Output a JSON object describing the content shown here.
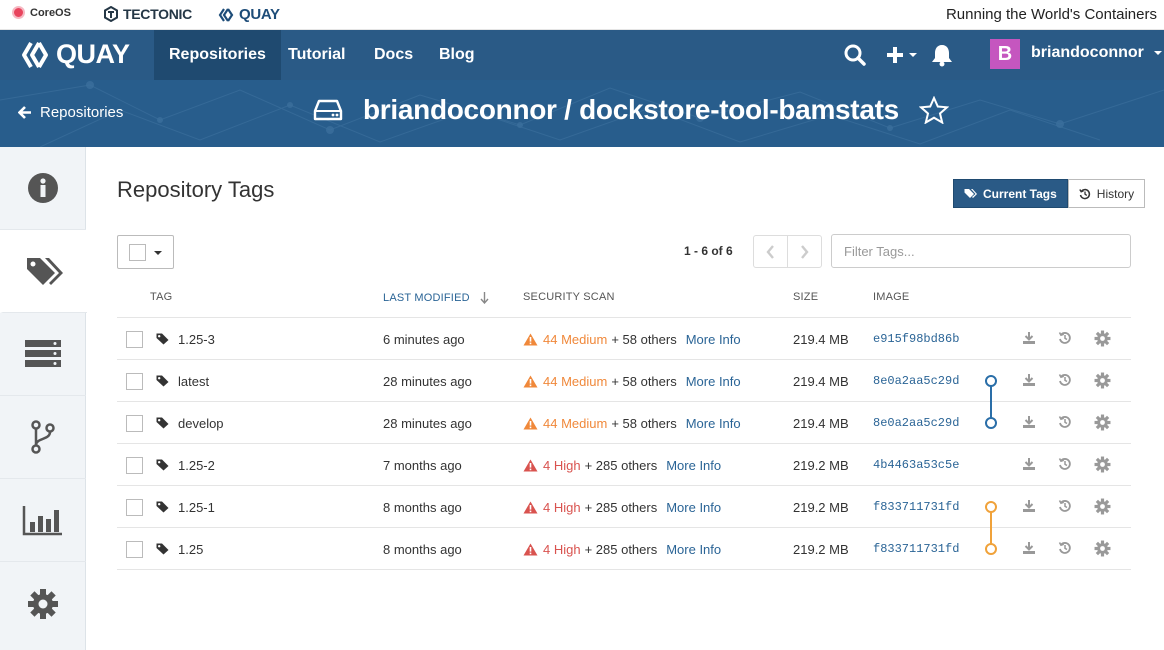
{
  "brands": {
    "coreos": "CoreOS",
    "tectonic": "TECTONIC",
    "quay": "QUAY",
    "tagline": "Running the World's Containers"
  },
  "navbar": {
    "logo": "QUAY",
    "items": [
      "Repositories",
      "Tutorial",
      "Docs",
      "Blog"
    ],
    "active": "Repositories",
    "icons": [
      "search-icon",
      "plus-icon",
      "bell-icon"
    ],
    "avatar_letter": "B",
    "avatar_color": "#c556bf",
    "username": "briandoconnor"
  },
  "header": {
    "back_label": "Repositories",
    "repo_title": "briandoconnor / dockstore-tool-bamstats"
  },
  "sidebar": {
    "tabs": [
      "info-icon",
      "tags-icon",
      "builds-icon",
      "branch-icon",
      "usage-icon",
      "settings-icon"
    ],
    "active": 1
  },
  "main": {
    "title": "Repository Tags",
    "view_buttons": [
      "Current Tags",
      "History"
    ],
    "pagination": "1 - 6 of 6",
    "filter_placeholder": "Filter Tags...",
    "columns": [
      "TAG",
      "LAST MODIFIED",
      "SECURITY SCAN",
      "SIZE",
      "IMAGE"
    ],
    "sorted_column": "LAST MODIFIED",
    "more_info_label": "More Info",
    "rows": [
      {
        "tag": "1.25-3",
        "modified": "6 minutes ago",
        "severity": "44 Medium",
        "others": "+ 58 others",
        "size": "219.4 MB",
        "image": "e915f98bd86b"
      },
      {
        "tag": "latest",
        "modified": "28 minutes ago",
        "severity": "44 Medium",
        "others": "+ 58 others",
        "size": "219.4 MB",
        "image": "8e0a2aa5c29d"
      },
      {
        "tag": "develop",
        "modified": "28 minutes ago",
        "severity": "44 Medium",
        "others": "+ 58 others",
        "size": "219.4 MB",
        "image": "8e0a2aa5c29d"
      },
      {
        "tag": "1.25-2",
        "modified": "7 months ago",
        "severity": "4 High",
        "others": "+ 285 others",
        "size": "219.2 MB",
        "image": "4b4463a53c5e"
      },
      {
        "tag": "1.25-1",
        "modified": "8 months ago",
        "severity": "4 High",
        "others": "+ 285 others",
        "size": "219.2 MB",
        "image": "f833711731fd"
      },
      {
        "tag": "1.25",
        "modified": "8 months ago",
        "severity": "4 High",
        "others": "+ 285 others",
        "size": "219.2 MB",
        "image": "f833711731fd"
      }
    ],
    "row_action_icons": [
      "download-icon",
      "history-icon",
      "gear-icon"
    ]
  },
  "colors": {
    "nav": "#2a5a86",
    "header": "#285d8c",
    "medium": "#f0883a",
    "high": "#d9534f",
    "link": "#2a6496",
    "image_link_blue": "#2a6ea8",
    "image_link_orange": "#f0a23a"
  }
}
